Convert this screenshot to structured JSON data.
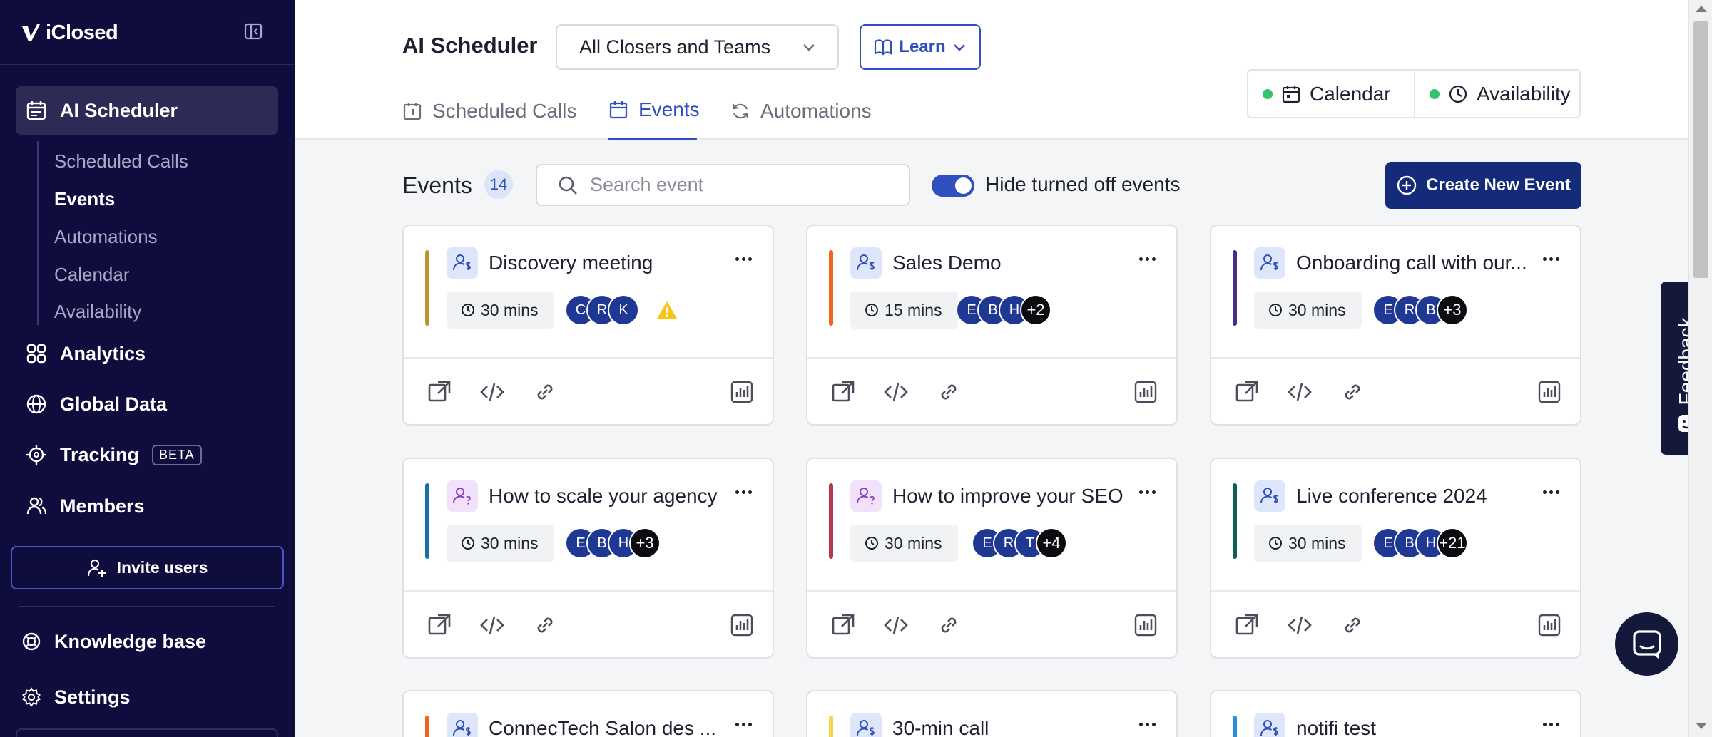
{
  "app": {
    "brand_name": "iClosed"
  },
  "sidebar": {
    "active_section": "AI Scheduler",
    "sub_items": [
      "Scheduled Calls",
      "Events",
      "Automations",
      "Calendar",
      "Availability"
    ],
    "active_sub_item": "Events",
    "items": [
      {
        "label": "Analytics",
        "icon": "grid-icon"
      },
      {
        "label": "Global Data",
        "icon": "globe-icon"
      },
      {
        "label": "Tracking",
        "icon": "target-icon",
        "badge": "BETA"
      },
      {
        "label": "Members",
        "icon": "users-icon"
      }
    ],
    "invite_label": "Invite users",
    "bottom_items": [
      {
        "label": "Knowledge base",
        "icon": "lifebuoy-icon"
      },
      {
        "label": "Settings",
        "icon": "gear-icon"
      }
    ]
  },
  "header": {
    "title": "AI Scheduler",
    "team_select": "All Closers and Teams",
    "learn_label": "Learn",
    "tabs": [
      {
        "label": "Scheduled Calls",
        "icon": "calendar-clock-icon",
        "active": false
      },
      {
        "label": "Events",
        "icon": "calendar-icon",
        "active": true
      },
      {
        "label": "Automations",
        "icon": "refresh-icon",
        "active": false
      }
    ],
    "status": [
      {
        "label": "Calendar",
        "icon": "calendar-icon",
        "connected": true
      },
      {
        "label": "Availability",
        "icon": "clock-icon",
        "connected": true
      }
    ],
    "status_color": "#34c46d"
  },
  "toolbar": {
    "title": "Events",
    "count": "14",
    "search_placeholder": "Search event",
    "toggle_label": "Hide turned off events",
    "toggle_on": true,
    "create_label": "Create New Event"
  },
  "events": [
    {
      "title": "Discovery meeting",
      "duration": "30 mins",
      "avatars": [
        "C",
        "R",
        "K"
      ],
      "more": "",
      "warning": true,
      "color": "#c0912f",
      "icon_type": "user-dollar-icon"
    },
    {
      "title": "Sales Demo",
      "duration": "15 mins",
      "avatars": [
        "E",
        "B",
        "H"
      ],
      "more": "+2",
      "warning": false,
      "color": "#f0641e",
      "icon_type": "user-dollar-icon"
    },
    {
      "title": "Onboarding call with our...",
      "duration": "30 mins",
      "avatars": [
        "E",
        "R",
        "B"
      ],
      "more": "+3",
      "warning": false,
      "color": "#4c2a8c",
      "icon_type": "user-dollar-icon"
    },
    {
      "title": "How to scale your agency",
      "duration": "30 mins",
      "avatars": [
        "E",
        "B",
        "H"
      ],
      "more": "+3",
      "warning": false,
      "color": "#1a6fa6",
      "icon_type": "user-question-icon"
    },
    {
      "title": "How to improve your SEO",
      "duration": "30 mins",
      "avatars": [
        "E",
        "R",
        "T"
      ],
      "more": "+4",
      "warning": false,
      "color": "#b6384e",
      "icon_type": "user-question-icon"
    },
    {
      "title": "Live conference 2024",
      "duration": "30 mins",
      "avatars": [
        "E",
        "B",
        "H"
      ],
      "more": "+21",
      "warning": false,
      "color": "#0e5f55",
      "icon_type": "user-dollar-icon"
    },
    {
      "title": "ConnecTech Salon des ...",
      "color": "#f0641e",
      "icon_type": "user-dollar-icon"
    },
    {
      "title": "30-min call",
      "color": "#f3d64a",
      "icon_type": "user-dollar-icon"
    },
    {
      "title": "notifi test",
      "color": "#2d8fd8",
      "icon_type": "user-dollar-icon"
    }
  ],
  "widgets": {
    "feedback_label": "Feedback"
  },
  "colors": {
    "sidebar_bg": "#0f0c3e",
    "accent": "#2f4fbf",
    "primary_button": "#142b7a"
  }
}
